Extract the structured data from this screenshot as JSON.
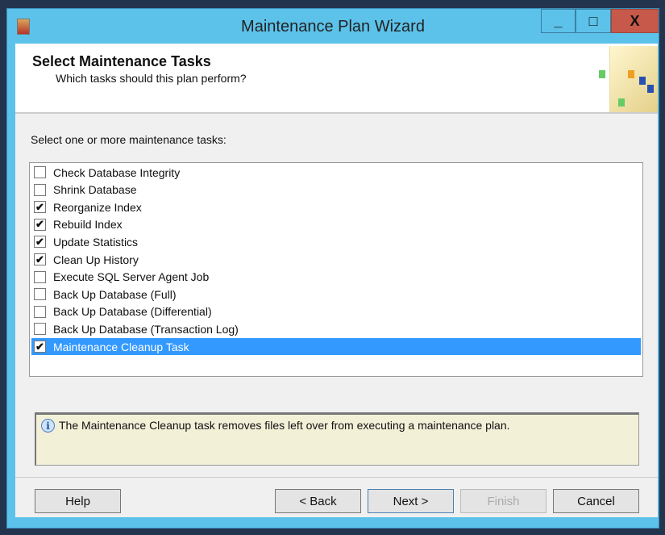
{
  "window": {
    "title": "Maintenance Plan Wizard",
    "minimize": "_",
    "maximize": "□",
    "close": "X"
  },
  "header": {
    "title": "Select Maintenance Tasks",
    "subtitle": "Which tasks should this plan perform?"
  },
  "list_label": "Select one or more maintenance tasks:",
  "tasks": [
    {
      "label": "Check Database Integrity",
      "checked": false
    },
    {
      "label": "Shrink Database",
      "checked": false
    },
    {
      "label": "Reorganize Index",
      "checked": true
    },
    {
      "label": "Rebuild Index",
      "checked": true
    },
    {
      "label": "Update Statistics",
      "checked": true
    },
    {
      "label": "Clean Up History",
      "checked": true
    },
    {
      "label": "Execute SQL Server Agent Job",
      "checked": false
    },
    {
      "label": "Back Up Database (Full)",
      "checked": false
    },
    {
      "label": "Back Up Database (Differential)",
      "checked": false
    },
    {
      "label": "Back Up Database (Transaction Log)",
      "checked": false
    },
    {
      "label": "Maintenance Cleanup Task",
      "checked": true,
      "selected": true
    }
  ],
  "info": "The Maintenance Cleanup task removes files left over from executing a maintenance plan.",
  "buttons": {
    "help": "Help",
    "back": "< Back",
    "next": "Next >",
    "finish": "Finish",
    "cancel": "Cancel"
  }
}
